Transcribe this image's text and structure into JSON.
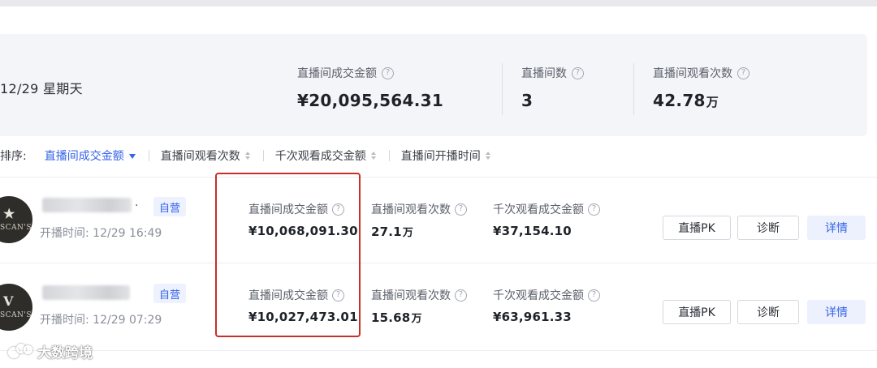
{
  "summary": {
    "date": "12/29 星期天",
    "metrics": [
      {
        "label": "直播间成交金额",
        "value": "¥20,095,564.31",
        "unit": ""
      },
      {
        "label": "直播间数",
        "value": "3",
        "unit": ""
      },
      {
        "label": "直播间观看次数",
        "value": "42.78",
        "unit": "万"
      }
    ]
  },
  "sort": {
    "label": "排序:",
    "options": [
      {
        "label": "直播间成交金额",
        "active": true
      },
      {
        "label": "直播间观看次数",
        "active": false
      },
      {
        "label": "千次观看成交金额",
        "active": false
      },
      {
        "label": "直播间开播时间",
        "active": false
      }
    ]
  },
  "help_glyph": "?",
  "rooms": [
    {
      "avatar_letter": "★",
      "avatar_brand": "SCAN'S",
      "name_suffix": ".",
      "tag": "自营",
      "start_time": "开播时间:  12/29 16:49",
      "gmv_label": "直播间成交金额",
      "gmv": "¥10,068,091.30",
      "views_label": "直播间观看次数",
      "views": "27.1",
      "views_unit": "万",
      "gpm_label": "千次观看成交金额",
      "gpm": "¥37,154.10",
      "btn_pk": "直播PK",
      "btn_diagnose": "诊断",
      "btn_detail": "详情"
    },
    {
      "avatar_letter": "V",
      "avatar_brand": "SCAN'S",
      "name_suffix": "",
      "tag": "自营",
      "start_time": "开播时间:  12/29 07:29",
      "gmv_label": "直播间成交金额",
      "gmv": "¥10,027,473.01",
      "views_label": "直播间观看次数",
      "views": "15.68",
      "views_unit": "万",
      "gpm_label": "千次观看成交金额",
      "gpm": "¥63,961.33",
      "btn_pk": "直播PK",
      "btn_diagnose": "诊断",
      "btn_detail": "详情"
    }
  ],
  "watermark": "大数跨境",
  "colors": {
    "accent": "#3563e9",
    "highlight_border": "#c7302a",
    "summary_bg": "#f4f5f8"
  }
}
